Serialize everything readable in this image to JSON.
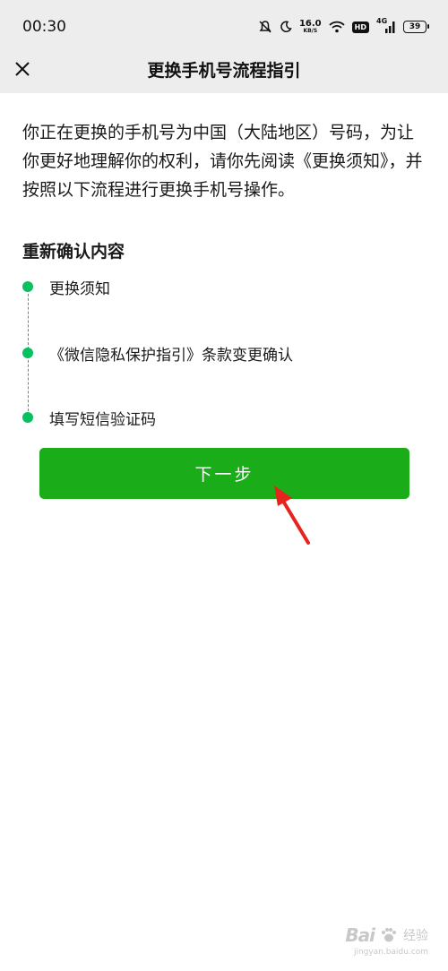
{
  "status_bar": {
    "time": "00:30",
    "net_speed_value": "16.0",
    "net_speed_unit": "KB/S",
    "hd_label": "HD",
    "signal_label": "4G",
    "battery": "39"
  },
  "nav": {
    "title": "更换手机号流程指引",
    "close_icon": "close-icon"
  },
  "intro_text": "你正在更换的手机号为中国（大陆地区）号码，为让你更好地理解你的权利，请你先阅读《更换须知》，并按照以下流程进行更换手机号操作。",
  "section_title": "重新确认内容",
  "steps": [
    {
      "label": "更换须知"
    },
    {
      "label": "《微信隐私保护指引》条款变更确认"
    },
    {
      "label": "填写短信验证码"
    }
  ],
  "next_button_label": "下一步",
  "colors": {
    "accent": "#1aad19",
    "step_dot": "#07c160",
    "header_bg": "#ededed",
    "annotation_arrow": "#e8231e"
  },
  "watermark": {
    "brand": "Bai",
    "sub": "经验",
    "url": "jingyan.baidu.com"
  }
}
